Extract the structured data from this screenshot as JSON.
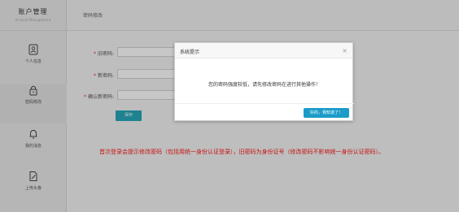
{
  "sidebar": {
    "title": "账户管理",
    "subtitle": "Account Management",
    "items": [
      {
        "label": "个人信息",
        "icon": "user-card-icon"
      },
      {
        "label": "密码修改",
        "icon": "lock-icon"
      },
      {
        "label": "我的消息",
        "icon": "bell-icon"
      },
      {
        "label": "上传头像",
        "icon": "edit-icon"
      }
    ]
  },
  "header": {
    "title": "密码修改"
  },
  "form": {
    "fields": [
      {
        "label": "旧密码",
        "required": true,
        "value": ""
      },
      {
        "label": "新密码",
        "required": true,
        "value": ""
      },
      {
        "label": "确认新密码",
        "required": true,
        "value": ""
      }
    ],
    "save_label": "保存"
  },
  "notice": "首次登录会提示修改密码（包括用统一身份认证登录），旧密码为身份证号（修改密码不影响统一身份认证密码）。",
  "dialog": {
    "title": "系统提示",
    "close_glyph": "×",
    "message": "您的密码强度较低，请先修改密码在进行其他操作！",
    "confirm_label": "好的，我知道了！"
  },
  "colors": {
    "accent": "#27a7ba",
    "dialog_button": "#1b9bc8",
    "notice": "#ff1a1a",
    "required": "#e23333"
  }
}
